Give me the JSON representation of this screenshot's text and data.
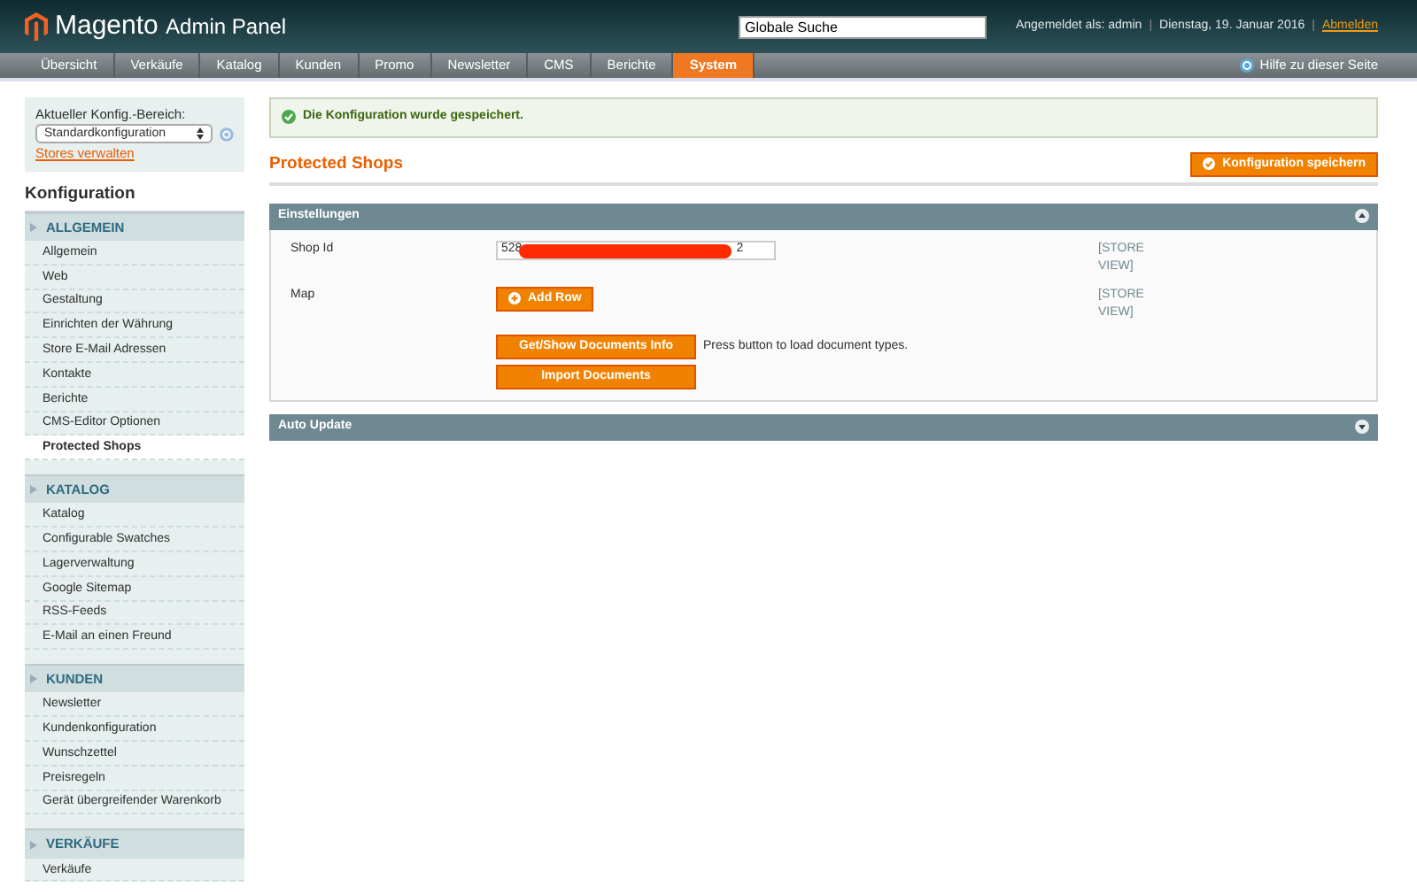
{
  "header": {
    "logo": "Magento",
    "logo_suffix": "Admin Panel",
    "search": {
      "value": "Globale Suche"
    },
    "user_info": "Angemeldet als: admin",
    "date": "Dienstag, 19. Januar 2016",
    "logout": "Abmelden",
    "separators": [
      "|",
      "|"
    ]
  },
  "nav": {
    "items": [
      {
        "label": "Übersicht",
        "selected": false
      },
      {
        "label": "Verkäufe",
        "selected": false
      },
      {
        "label": "Katalog",
        "selected": false
      },
      {
        "label": "Kunden",
        "selected": false
      },
      {
        "label": "Promo",
        "selected": false
      },
      {
        "label": "Newsletter",
        "selected": false
      },
      {
        "label": "CMS",
        "selected": false
      },
      {
        "label": "Berichte",
        "selected": false
      },
      {
        "label": "System",
        "selected": true
      }
    ],
    "help": "Hilfe zu dieser Seite"
  },
  "sidebar": {
    "scope_label": "Aktueller Konfig.-Bereich:",
    "scope_value": "Standardkonfiguration",
    "manage_stores": "Stores verwalten",
    "title": "Konfiguration",
    "sections": [
      {
        "title": "ALLGEMEIN",
        "items": [
          {
            "label": "Allgemein",
            "selected": false
          },
          {
            "label": "Web",
            "selected": false
          },
          {
            "label": "Gestaltung",
            "selected": false
          },
          {
            "label": "Einrichten der Währung",
            "selected": false
          },
          {
            "label": "Store E-Mail Adressen",
            "selected": false
          },
          {
            "label": "Kontakte",
            "selected": false
          },
          {
            "label": "Berichte",
            "selected": false
          },
          {
            "label": "CMS-Editor Optionen",
            "selected": false
          },
          {
            "label": "Protected Shops",
            "selected": true
          }
        ]
      },
      {
        "title": "KATALOG",
        "items": [
          {
            "label": "Katalog",
            "selected": false
          },
          {
            "label": "Configurable Swatches",
            "selected": false
          },
          {
            "label": "Lagerverwaltung",
            "selected": false
          },
          {
            "label": "Google Sitemap",
            "selected": false
          },
          {
            "label": "RSS-Feeds",
            "selected": false
          },
          {
            "label": "E-Mail an einen Freund",
            "selected": false
          }
        ]
      },
      {
        "title": "KUNDEN",
        "items": [
          {
            "label": "Newsletter",
            "selected": false
          },
          {
            "label": "Kundenkonfiguration",
            "selected": false
          },
          {
            "label": "Wunschzettel",
            "selected": false
          },
          {
            "label": "Preisregeln",
            "selected": false
          },
          {
            "label": "Gerät übergreifender Warenkorb",
            "selected": false
          }
        ]
      },
      {
        "title": "VERKÄUFE",
        "items": [
          {
            "label": "Verkäufe",
            "selected": false
          }
        ]
      }
    ]
  },
  "message": "Die Konfiguration wurde gespeichert.",
  "page_title": "Protected Shops",
  "save_button": "Konfiguration speichern",
  "groups": [
    {
      "title": "Einstellungen",
      "expanded": true,
      "rows": [
        {
          "kind": "field",
          "label": "Shop Id",
          "value_start": "528",
          "value_end": "2",
          "redacted": true,
          "scope": "[STORE VIEW]"
        },
        {
          "kind": "button",
          "label": "Map",
          "button": "Add Row",
          "scope": "[STORE VIEW]"
        },
        {
          "kind": "action",
          "button": "Get/Show Documents Info",
          "note": "Press button to load document types."
        },
        {
          "kind": "action",
          "button": "Import Documents"
        }
      ]
    },
    {
      "title": "Auto Update",
      "expanded": false
    }
  ]
}
